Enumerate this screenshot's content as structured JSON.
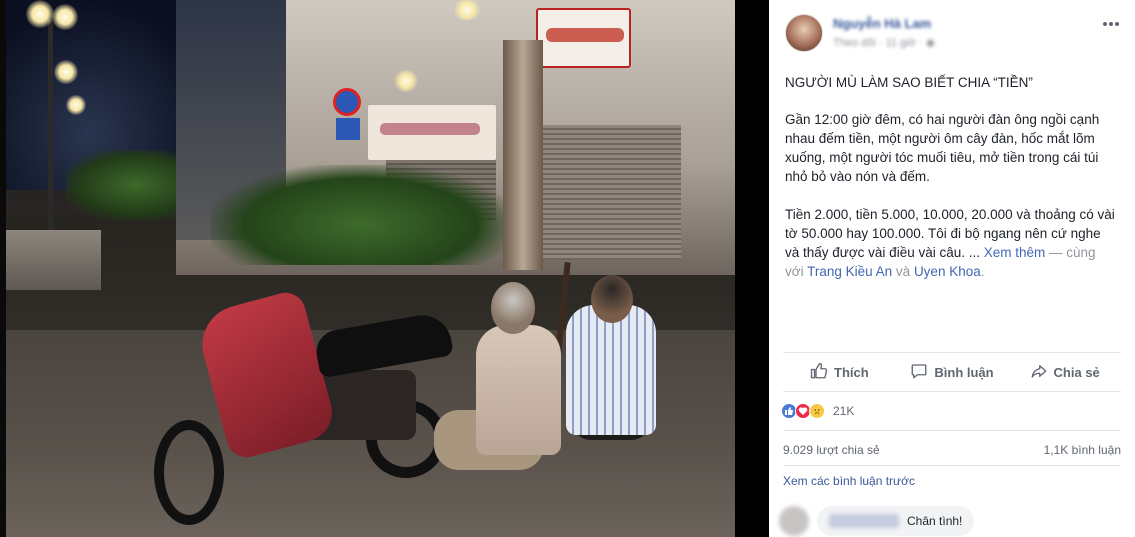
{
  "post": {
    "author": "Nguyễn Hà Lam",
    "meta": "Theo dõi · 11 giờ · ",
    "title": "NGƯỜI MÙ LÀM SAO BIẾT CHIA “TIỀN”",
    "paragraph1": "Gần 12:00 giờ đêm, có hai người đàn ông ngồi cạnh nhau đếm tiền, một người ôm cây đàn, hốc mắt lõm xuống, một người tóc muối tiêu, mở tiền trong cái túi nhỏ bỏ vào nón và đếm.",
    "paragraph2": "Tiền 2.000, tiền 5.000, 10.000, 20.000 và thoảng có vài tờ 50.000 hay 100.000. Tôi đi bộ ngang nên cứ nghe và thấy được vài điều vài câu. ... ",
    "see_more": "Xem thêm",
    "with_prefix": " — cùng với ",
    "tagged1": "Trang Kiều An",
    "and": " và ",
    "tagged2": "Uyen Khoa",
    "period": "."
  },
  "actions": {
    "like": "Thích",
    "comment": "Bình luận",
    "share": "Chia sẻ"
  },
  "reactions": {
    "count": "21K",
    "types": [
      "like",
      "love",
      "sad"
    ]
  },
  "stats": {
    "shares": "9.029 lượt chia sẻ",
    "comments": "1,1K bình luận"
  },
  "comments": {
    "view_previous": "Xem các bình luận trước",
    "first_comment_text": "Chân tình!"
  },
  "colors": {
    "link": "#385898",
    "text": "#1d2129",
    "muted": "#606770"
  }
}
